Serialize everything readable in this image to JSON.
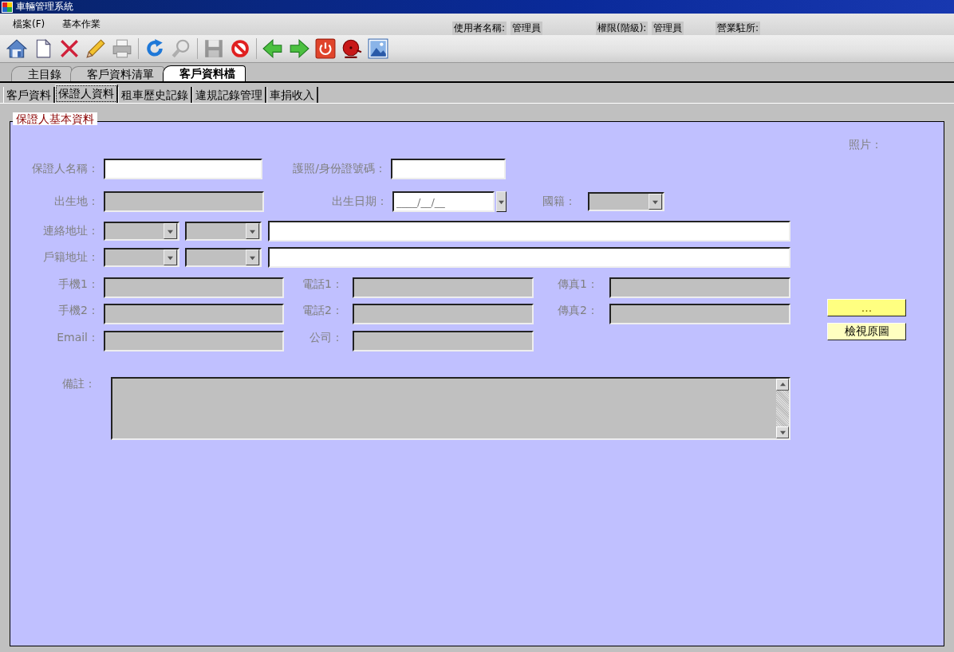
{
  "window": {
    "title": "車輛管理系統"
  },
  "menu": [
    "檔案(F)",
    "基本作業"
  ],
  "user_info": [
    {
      "label": "使用者名稱:",
      "value": "管理員"
    },
    {
      "label": "權限(階級):",
      "value": "管理員"
    },
    {
      "label": "營業駐所:"
    }
  ],
  "toolbar": [
    [
      {
        "kind": "home",
        "disabled": false
      },
      {
        "kind": "document",
        "disabled": false
      },
      {
        "kind": "cross",
        "disabled": false
      },
      {
        "kind": "pencil",
        "disabled": false
      },
      {
        "kind": "printer",
        "disabled": true
      }
    ],
    [
      {
        "kind": "refresh",
        "disabled": false
      },
      {
        "kind": "search",
        "disabled": true
      }
    ],
    [
      {
        "kind": "floppy",
        "disabled": true
      },
      {
        "kind": "stop",
        "disabled": false
      }
    ],
    [
      {
        "kind": "left",
        "disabled": false
      },
      {
        "kind": "right",
        "disabled": false
      },
      {
        "kind": "power",
        "disabled": false
      },
      {
        "kind": "bell",
        "disabled": false
      },
      {
        "kind": "image",
        "disabled": false
      }
    ]
  ],
  "main_tabs": [
    {
      "label": "主目錄",
      "selected": false
    },
    {
      "label": "客戶資料清單",
      "selected": false
    },
    {
      "label": "客戶資料檔",
      "selected": true
    }
  ],
  "sub_tabs": [
    {
      "label": "客戶資料",
      "selected": false
    },
    {
      "label": "保證人資料",
      "selected": true
    },
    {
      "label": "租車歷史記錄",
      "selected": false
    },
    {
      "label": "違規記錄管理",
      "selected": false
    },
    {
      "label": "車捐收入",
      "selected": false
    }
  ],
  "form": {
    "legend": "保證人基本資料",
    "photo_label": "照片：",
    "rows": [
      {
        "items": [
          {
            "kind": "label",
            "text": "保證人名稱："
          },
          {
            "kind": "text",
            "disabled": false
          },
          {
            "kind": "label",
            "text": "護照/身份證號碼："
          },
          {
            "kind": "text",
            "disabled": false
          }
        ]
      },
      {
        "items": [
          {
            "kind": "label",
            "text": "出生地："
          },
          {
            "kind": "text",
            "disabled": true
          },
          {
            "kind": "label",
            "text": "出生日期："
          },
          {
            "kind": "date",
            "disabled": false,
            "placeholder": "____/__/__"
          },
          {
            "kind": "label",
            "text": "國籍："
          },
          {
            "kind": "combo",
            "disabled": true
          }
        ]
      },
      {
        "items": [
          {
            "kind": "label",
            "text": "連絡地址："
          },
          {
            "kind": "combo",
            "disabled": true
          },
          {
            "kind": "combo",
            "disabled": true
          },
          {
            "kind": "text",
            "disabled": false
          }
        ]
      },
      {
        "items": [
          {
            "kind": "label",
            "text": "戶籍地址："
          },
          {
            "kind": "combo",
            "disabled": true
          },
          {
            "kind": "combo",
            "disabled": true
          },
          {
            "kind": "text",
            "disabled": false
          }
        ]
      },
      {
        "items": [
          {
            "kind": "label",
            "text": "手機1："
          },
          {
            "kind": "text",
            "disabled": true
          },
          {
            "kind": "label",
            "text": "電話1："
          },
          {
            "kind": "text",
            "disabled": true
          },
          {
            "kind": "label",
            "text": "傳真1："
          },
          {
            "kind": "text",
            "disabled": true
          }
        ]
      },
      {
        "items": [
          {
            "kind": "label",
            "text": "手機2："
          },
          {
            "kind": "text",
            "disabled": true
          },
          {
            "kind": "label",
            "text": "電話2："
          },
          {
            "kind": "text",
            "disabled": true
          },
          {
            "kind": "label",
            "text": "傳真2："
          },
          {
            "kind": "text",
            "disabled": true
          }
        ]
      },
      {
        "items": [
          {
            "kind": "label",
            "text": "Email："
          },
          {
            "kind": "text",
            "disabled": true
          },
          {
            "kind": "label",
            "text": "公司："
          },
          {
            "kind": "text",
            "disabled": true
          }
        ]
      },
      {
        "items": [
          {
            "kind": "label",
            "text": "備註："
          },
          {
            "kind": "textarea",
            "disabled": true
          }
        ]
      }
    ],
    "buttons": [
      {
        "label": "...",
        "highlighted": true
      },
      {
        "label": "檢視原圖",
        "highlighted": false
      }
    ]
  }
}
